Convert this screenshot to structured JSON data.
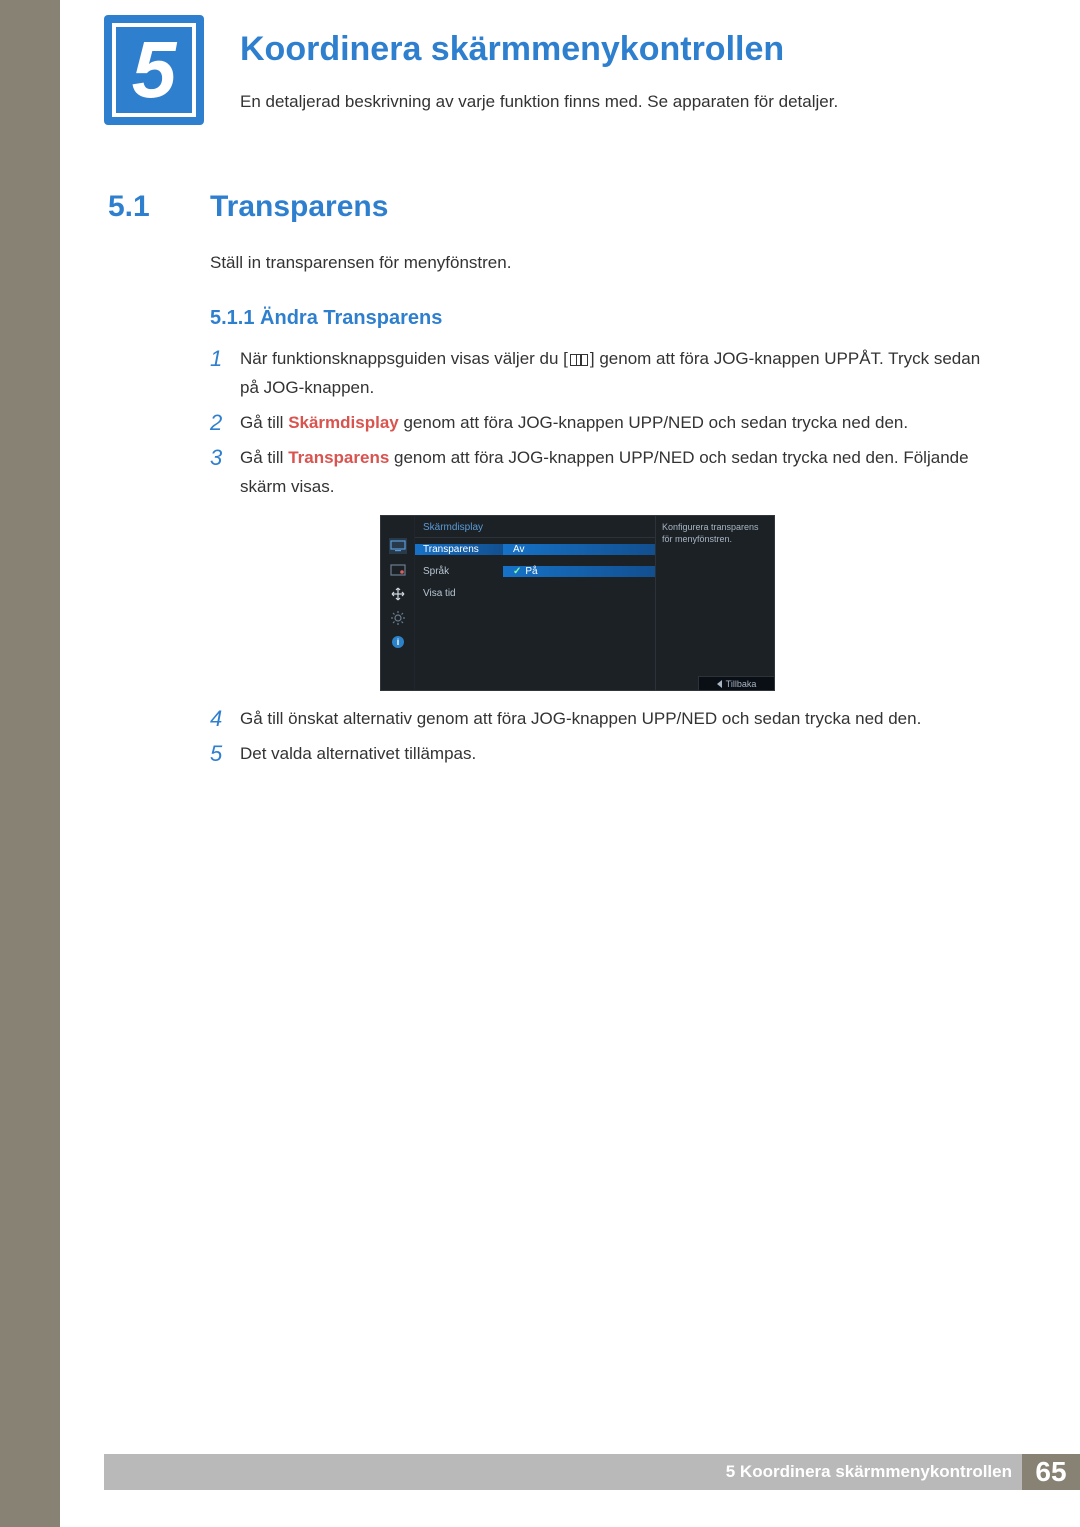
{
  "chapter": {
    "number": "5",
    "title": "Koordinera skärmmenykontrollen",
    "description": "En detaljerad beskrivning av varje funktion finns med. Se apparaten för detaljer."
  },
  "section": {
    "number": "5.1",
    "title": "Transparens",
    "description": "Ställ in transparensen för menyfönstren."
  },
  "subsection": {
    "title": "5.1.1   Ändra Transparens"
  },
  "steps": {
    "s1": {
      "num": "1",
      "t1": "När funktionsknappsguiden visas väljer du [",
      "t2": "] genom att föra JOG-knappen UPPÅT. Tryck sedan på JOG-knappen."
    },
    "s2": {
      "num": "2",
      "t1": "Gå till ",
      "hl": "Skärmdisplay",
      "t2": " genom att föra JOG-knappen UPP/NED och sedan trycka ned den."
    },
    "s3": {
      "num": "3",
      "t1": "Gå till ",
      "hl": "Transparens",
      "t2": " genom att föra JOG-knappen UPP/NED och sedan trycka ned den. Följande skärm visas."
    },
    "s4": {
      "num": "4",
      "t": "Gå till önskat alternativ genom att föra JOG-knappen UPP/NED och sedan trycka ned den."
    },
    "s5": {
      "num": "5",
      "t": "Det valda alternativet tillämpas."
    }
  },
  "osd": {
    "header": "Skärmdisplay",
    "row1": {
      "label": "Transparens",
      "value": "Av"
    },
    "row2": {
      "label": "Språk",
      "value": "På"
    },
    "row3": {
      "label": "Visa tid"
    },
    "tooltip": "Konfigurera transparens för menyfönstren.",
    "back": "Tillbaka"
  },
  "footer": {
    "chapter_label": "5 Koordinera skärmmenykontrollen",
    "page_number": "65"
  }
}
